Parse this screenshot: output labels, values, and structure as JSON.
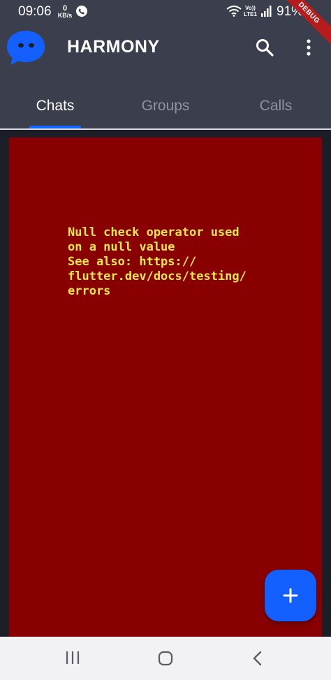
{
  "status_bar": {
    "time": "09:06",
    "speed_value": "0",
    "speed_unit": "KB/s",
    "network_top": "Vo))",
    "network_bottom": "LTE1",
    "battery": "91%",
    "icons": [
      "call-icon",
      "wifi-icon",
      "signal-icon"
    ]
  },
  "debug_banner": "DEBUG",
  "app_bar": {
    "title": "HARMONY",
    "icons": [
      "app-logo-icon",
      "search-icon",
      "more-vert-icon"
    ]
  },
  "tabs": [
    {
      "label": "Chats",
      "selected": true
    },
    {
      "label": "Groups",
      "selected": false
    },
    {
      "label": "Calls",
      "selected": false
    }
  ],
  "error": {
    "message": "Null check operator used\non a null value\nSee also: https://\nflutter.dev/docs/testing/\nerrors"
  },
  "fab": {
    "icon": "plus-icon"
  },
  "nav_bar": {
    "icons": [
      "recents-icon",
      "home-icon",
      "back-icon"
    ]
  },
  "colors": {
    "app_bar": "#3a3e4d",
    "background": "#1b1e27",
    "accent": "#1460ff",
    "error_bg": "#880000",
    "error_text": "#f5e84a"
  }
}
